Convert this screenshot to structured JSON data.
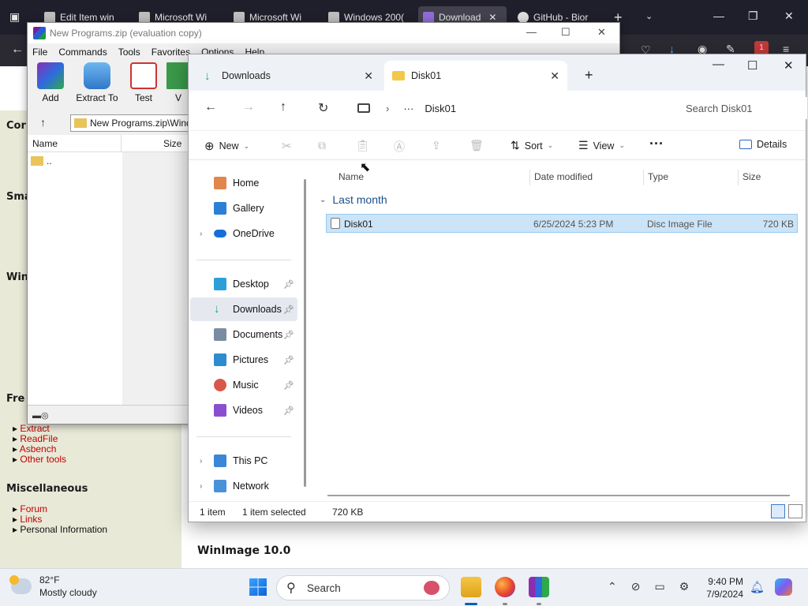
{
  "browser": {
    "tabs": [
      {
        "label": "Edit Item win"
      },
      {
        "label": "Microsoft Wi"
      },
      {
        "label": "Microsoft Wi"
      },
      {
        "label": "Windows 200("
      },
      {
        "label": "Download"
      },
      {
        "label": "GitHub - Bior"
      }
    ],
    "new_tab": "+",
    "badge": "1"
  },
  "web": {
    "sidebar": {
      "headings": [
        "Cor",
        "Sma",
        "Win",
        "Fre",
        "Miscellaneous"
      ],
      "free_links": [
        "Extract",
        "ReadFile",
        "Asbench",
        "Other tools"
      ],
      "misc_links": [
        "Forum",
        "Links",
        "Personal Information"
      ]
    },
    "article_title": "WinImage 10.0"
  },
  "winrar": {
    "title": "New Programs.zip (evaluation copy)",
    "menu": [
      "File",
      "Commands",
      "Tools",
      "Favorites",
      "Options",
      "Help"
    ],
    "tools": [
      "Add",
      "Extract To",
      "Test",
      "V"
    ],
    "path": "New Programs.zip\\Wind",
    "columns": {
      "name": "Name",
      "size": "Size"
    },
    "rows": [
      {
        "name": ".."
      }
    ]
  },
  "explorer": {
    "tabs": [
      {
        "label": "Downloads"
      },
      {
        "label": "Disk01"
      }
    ],
    "new_tab": "+",
    "breadcrumb": {
      "more": "···",
      "current": "Disk01"
    },
    "search_placeholder": "Search Disk01",
    "commands": {
      "new": "New",
      "sort": "Sort",
      "view": "View",
      "more": "···",
      "details": "Details"
    },
    "nav": {
      "top": [
        {
          "label": "Home"
        },
        {
          "label": "Gallery"
        },
        {
          "label": "OneDrive"
        }
      ],
      "quick": [
        {
          "label": "Desktop"
        },
        {
          "label": "Downloads"
        },
        {
          "label": "Documents"
        },
        {
          "label": "Pictures"
        },
        {
          "label": "Music"
        },
        {
          "label": "Videos"
        }
      ],
      "bottom": [
        {
          "label": "This PC"
        },
        {
          "label": "Network"
        }
      ]
    },
    "columns": {
      "name": "Name",
      "date": "Date modified",
      "type": "Type",
      "size": "Size"
    },
    "group": "Last month",
    "files": [
      {
        "name": "Disk01",
        "date": "6/25/2024 5:23 PM",
        "type": "Disc Image File",
        "size": "720 KB"
      }
    ],
    "status": {
      "count": "1 item",
      "selected": "1 item selected",
      "size": "720 KB"
    }
  },
  "taskbar": {
    "weather_temp": "82°F",
    "weather_desc": "Mostly cloudy",
    "search_label": "Search",
    "time": "9:40 PM",
    "date": "7/9/2024"
  },
  "colors": {
    "accent": "#005fb8",
    "selection": "#cce4f7",
    "link_red": "#c00000"
  }
}
